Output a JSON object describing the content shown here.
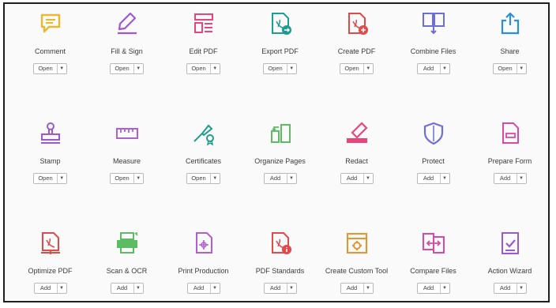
{
  "tools": [
    {
      "label": "Comment",
      "button": "Open",
      "icon": "comment-icon",
      "color": "#e8b92e"
    },
    {
      "label": "Fill & Sign",
      "button": "Open",
      "icon": "fill-sign-icon",
      "color": "#9b59d0"
    },
    {
      "label": "Edit PDF",
      "button": "Open",
      "icon": "edit-pdf-icon",
      "color": "#e8457f"
    },
    {
      "label": "Export PDF",
      "button": "Open",
      "icon": "export-pdf-icon",
      "color": "#1f9b8f"
    },
    {
      "label": "Create PDF",
      "button": "Open",
      "icon": "create-pdf-icon",
      "color": "#e24a4a"
    },
    {
      "label": "Combine Files",
      "button": "Add",
      "icon": "combine-files-icon",
      "color": "#6d6fd8"
    },
    {
      "label": "Share",
      "button": "Open",
      "icon": "share-icon",
      "color": "#2a8fd8"
    },
    {
      "label": "Stamp",
      "button": "Open",
      "icon": "stamp-icon",
      "color": "#9b59d0"
    },
    {
      "label": "Measure",
      "button": "Open",
      "icon": "measure-icon",
      "color": "#b05fd0"
    },
    {
      "label": "Certificates",
      "button": "Open",
      "icon": "certificates-icon",
      "color": "#1f9b8f"
    },
    {
      "label": "Organize Pages",
      "button": "Add",
      "icon": "organize-pages-icon",
      "color": "#5dbb63"
    },
    {
      "label": "Redact",
      "button": "Add",
      "icon": "redact-icon",
      "color": "#e8457f"
    },
    {
      "label": "Protect",
      "button": "Add",
      "icon": "protect-icon",
      "color": "#6d6fd8"
    },
    {
      "label": "Prepare Form",
      "button": "Add",
      "icon": "prepare-form-icon",
      "color": "#d94aa8"
    },
    {
      "label": "Optimize PDF",
      "button": "Add",
      "icon": "optimize-pdf-icon",
      "color": "#e24a4a"
    },
    {
      "label": "Scan & OCR",
      "button": "Add",
      "icon": "scan-ocr-icon",
      "color": "#5dbb63"
    },
    {
      "label": "Print Production",
      "button": "Add",
      "icon": "print-production-icon",
      "color": "#b05fd0"
    },
    {
      "label": "PDF Standards",
      "button": "Add",
      "icon": "pdf-standards-icon",
      "color": "#e24a4a"
    },
    {
      "label": "Create Custom Tool",
      "button": "Add",
      "icon": "create-custom-tool-icon",
      "color": "#e8952e"
    },
    {
      "label": "Compare Files",
      "button": "Add",
      "icon": "compare-files-icon",
      "color": "#d94aa8"
    },
    {
      "label": "Action Wizard",
      "button": "Add",
      "icon": "action-wizard-icon",
      "color": "#9b59d0"
    }
  ]
}
